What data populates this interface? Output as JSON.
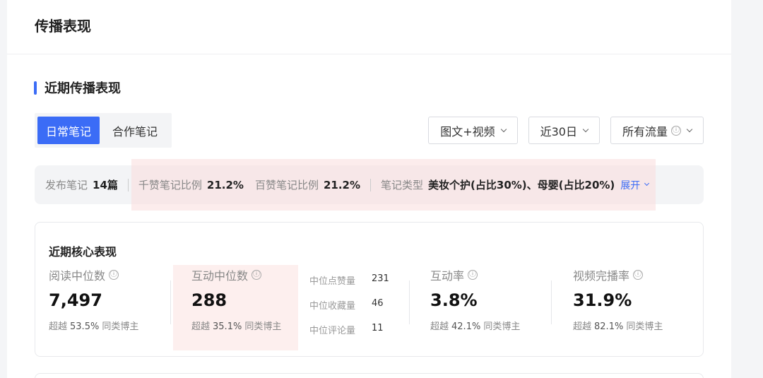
{
  "header": {
    "title": "传播表现"
  },
  "section": {
    "title": "近期传播表现"
  },
  "tabs": [
    {
      "label": "日常笔记",
      "active": true
    },
    {
      "label": "合作笔记",
      "active": false
    }
  ],
  "filters": {
    "content_type": "图文+视频",
    "period": "近30日",
    "traffic": "所有流量"
  },
  "summary": {
    "published_label": "发布笔记",
    "published_value": "14篇",
    "k_like_label": "千赞笔记比例",
    "k_like_value": "21.2%",
    "h_like_label": "百赞笔记比例",
    "h_like_value": "21.2%",
    "type_label": "笔记类型",
    "type_value": "美妆个护(占比30%)、母婴(占比20%)",
    "expand_label": "展开"
  },
  "core": {
    "title": "近期核心表现",
    "metrics": [
      {
        "label": "阅读中位数",
        "value": "7,497",
        "sub_prefix": "超越",
        "sub_pct": "53.5%",
        "sub_suffix": "同类博主"
      },
      {
        "label": "互动中位数",
        "value": "288",
        "sub_prefix": "超越",
        "sub_pct": "35.1%",
        "sub_suffix": "同类博主"
      },
      {
        "label": "互动率",
        "value": "3.8%",
        "sub_prefix": "超越",
        "sub_pct": "42.1%",
        "sub_suffix": "同类博主"
      },
      {
        "label": "视频完播率",
        "value": "31.9%",
        "sub_prefix": "超越",
        "sub_pct": "82.1%",
        "sub_suffix": "同类博主"
      }
    ],
    "mini": [
      {
        "label": "中位点赞量",
        "value": "231"
      },
      {
        "label": "中位收藏量",
        "value": "46"
      },
      {
        "label": "中位评论量",
        "value": "11"
      }
    ]
  },
  "icons": {
    "info": "ⓘ"
  },
  "colors": {
    "accent": "#3b6cf6",
    "highlight": "#fbe2e0"
  }
}
